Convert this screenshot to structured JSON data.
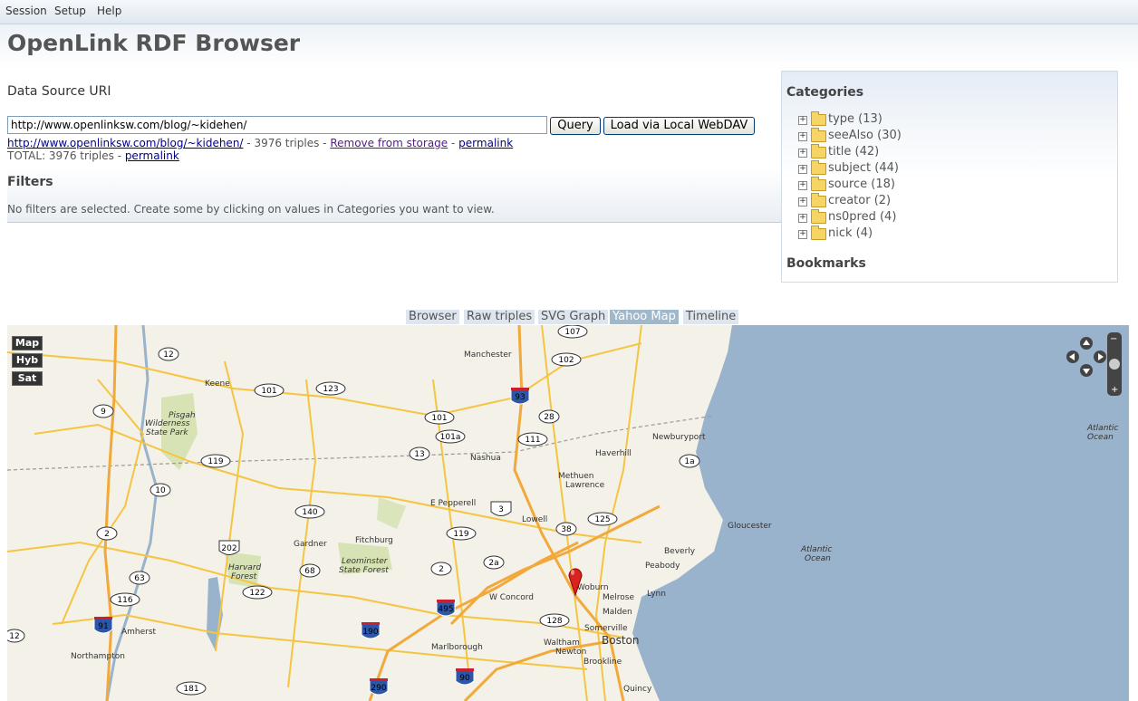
{
  "menu": [
    "Session",
    "Setup",
    "Help"
  ],
  "app_title": "OpenLink RDF Browser",
  "data_source": {
    "heading": "Data Source URI",
    "uri_value": "http://www.openlinksw.com/blog/~kidehen/",
    "query_label": "Query",
    "load_label": "Load via Local WebDAV",
    "source_link": "http://www.openlinksw.com/blog/~kidehen/",
    "source_triples": "- 3976 triples -",
    "remove_link": "Remove from storage",
    "dash": "-",
    "permalink": "permalink",
    "total_text": "TOTAL: 3976 triples -",
    "total_permalink": "permalink"
  },
  "filters": {
    "heading": "Filters",
    "message": "No filters are selected. Create some by clicking on values in Categories you want to view."
  },
  "categories": {
    "heading": "Categories",
    "items": [
      {
        "label": "type (13)"
      },
      {
        "label": "seeAlso (30)"
      },
      {
        "label": "title (42)"
      },
      {
        "label": "subject (44)"
      },
      {
        "label": "source (18)"
      },
      {
        "label": "creator (2)"
      },
      {
        "label": "ns0pred (4)"
      },
      {
        "label": "nick (4)"
      }
    ],
    "bookmarks_heading": "Bookmarks"
  },
  "view_tabs": [
    {
      "label": "Browser",
      "active": false
    },
    {
      "label": "Raw triples",
      "active": false
    },
    {
      "label": "SVG Graph",
      "active": false
    },
    {
      "label": "Yahoo Map",
      "active": true
    },
    {
      "label": "Timeline",
      "active": false
    }
  ],
  "map": {
    "type_buttons": [
      "Map",
      "Hyb",
      "Sat"
    ],
    "places": [
      "Manchester",
      "Keene",
      "Pisgah",
      "Wilderness",
      "State Park",
      "Nashua",
      "Haverhill",
      "Newburyport",
      "Methuen",
      "Lawrence",
      "E Pepperell",
      "Lowell",
      "Gloucester",
      "Fitchburg",
      "Gardner",
      "Leominster",
      "State Forest",
      "Harvard",
      "Forest",
      "Beverly",
      "Peabody",
      "Lynn",
      "Woburn",
      "Melrose",
      "Malden",
      "W Concord",
      "Somerville",
      "Boston",
      "Waltham",
      "Newton",
      "Brookline",
      "Quincy",
      "Marlborough",
      "Amherst",
      "Northampton",
      "Atlantic",
      "Ocean"
    ],
    "route_shields": [
      "107",
      "12",
      "102",
      "101",
      "123",
      "93",
      "9",
      "101",
      "28",
      "101a",
      "111",
      "13",
      "119",
      "10",
      "1a",
      "140",
      "3",
      "125",
      "2",
      "38",
      "119",
      "202",
      "68",
      "2",
      "2a",
      "63",
      "116",
      "122",
      "495",
      "128",
      "91",
      "190",
      "12",
      "181",
      "290",
      "90"
    ],
    "colors": {
      "water": "#99b3cc",
      "land": "#f3f1e8",
      "road": "#f5c542",
      "highway": "#f2a93b",
      "park": "#cfe0a8"
    }
  }
}
